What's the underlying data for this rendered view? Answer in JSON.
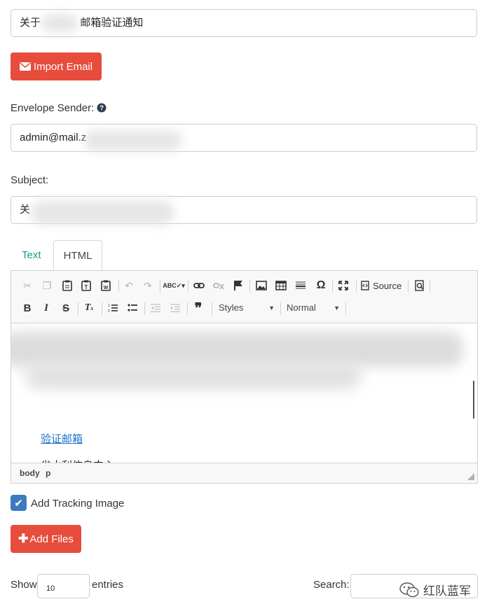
{
  "top_input": {
    "prefix": "关于",
    "suffix": "邮箱验证通知"
  },
  "import_button": {
    "label": "Import Email",
    "icon": "envelope-icon"
  },
  "envelope_sender": {
    "label": "Envelope Sender:",
    "help_icon": "question-circle-icon",
    "value": "admin@mail.z"
  },
  "subject": {
    "label": "Subject:",
    "value": "关"
  },
  "tabs": [
    {
      "label": "Text"
    },
    {
      "label": "HTML"
    }
  ],
  "toolbar": {
    "row1": [
      "cut-icon",
      "copy-icon",
      "paste-icon",
      "paste-text-icon",
      "paste-word-icon",
      "undo-icon",
      "redo-icon",
      "spellcheck-icon",
      "link-icon",
      "unlink-icon",
      "anchor-flag-icon",
      "image-icon",
      "table-icon",
      "horizontal-line-icon",
      "special-char-icon",
      "maximize-icon",
      "source-icon",
      "preview-icon"
    ],
    "source_label": "Source",
    "styles_label": "Styles",
    "format_label": "Normal"
  },
  "editor_content": {
    "link_text": "验证邮箱",
    "partial_text": "省水利信息中心"
  },
  "statusbar": {
    "path": [
      "body",
      "p"
    ]
  },
  "tracking": {
    "label": "Add Tracking Image",
    "checked": true
  },
  "add_files": {
    "label": "Add Files",
    "icon": "plus-icon"
  },
  "table_controls": {
    "show_label": "Show",
    "show_value": "10",
    "entries_label": "entries",
    "search_label": "Search:",
    "search_value": ""
  },
  "watermark": {
    "text": "红队蓝军"
  },
  "colors": {
    "danger": "#e74c3c",
    "link": "#1a73c9",
    "tab_link": "#1a9c8f",
    "checkbox": "#3b7bbf"
  }
}
